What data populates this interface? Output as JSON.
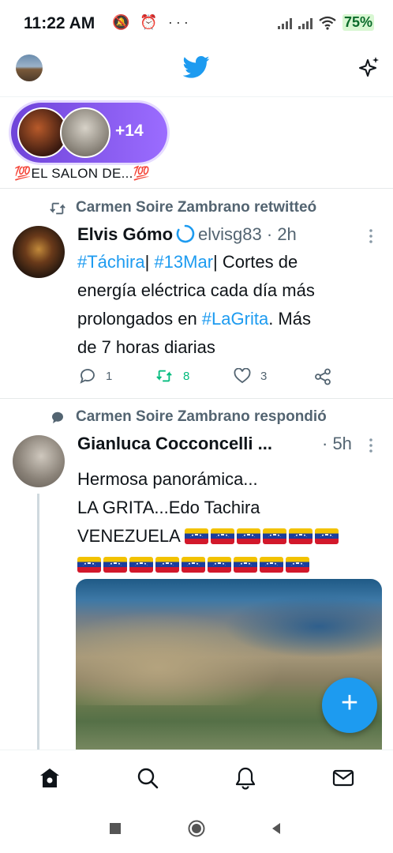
{
  "status_bar": {
    "time": "11:22 AM",
    "icons": "🔕 ⏰ ···",
    "battery": "75%"
  },
  "top_bar": {
    "title_icon": "twitter-bird-icon"
  },
  "spaces": {
    "extra_count": "+14",
    "title": "💯EL SALON DE...💯"
  },
  "tweets": [
    {
      "context": "Carmen Soire Zambrano retwitteó",
      "name": "Elvis Gómo",
      "meta": "elvisg83 · 2h",
      "lines": [
        [
          "#Táchira",
          "| ",
          "#13Mar",
          "|  Cortes de"
        ],
        "energía eléctrica cada día más",
        [
          "prolongados en ",
          "#LaGrita",
          ".  Más"
        ],
        "de 7 horas diarias"
      ],
      "replies": "1",
      "retweets": "8",
      "likes": "3"
    },
    {
      "context": "Carmen Soire Zambrano respondió",
      "name": "Gianluca Cocconcelli ...",
      "meta": "· 5h",
      "line1": "Hermosa panorámica...",
      "line2": "LA GRITA...Edo Tachira",
      "line3": "VENEZUELA",
      "flags_row1": 6,
      "flags_row2": 9
    }
  ],
  "colors": {
    "accent": "#1d9bf0",
    "retweet_green": "#00ba7c",
    "space_purple": "#7c55e8"
  },
  "tab_bar": [
    "home-icon",
    "search-icon",
    "notifications-icon",
    "messages-icon"
  ],
  "nav_bar": [
    "recents-button",
    "home-button",
    "back-button"
  ]
}
